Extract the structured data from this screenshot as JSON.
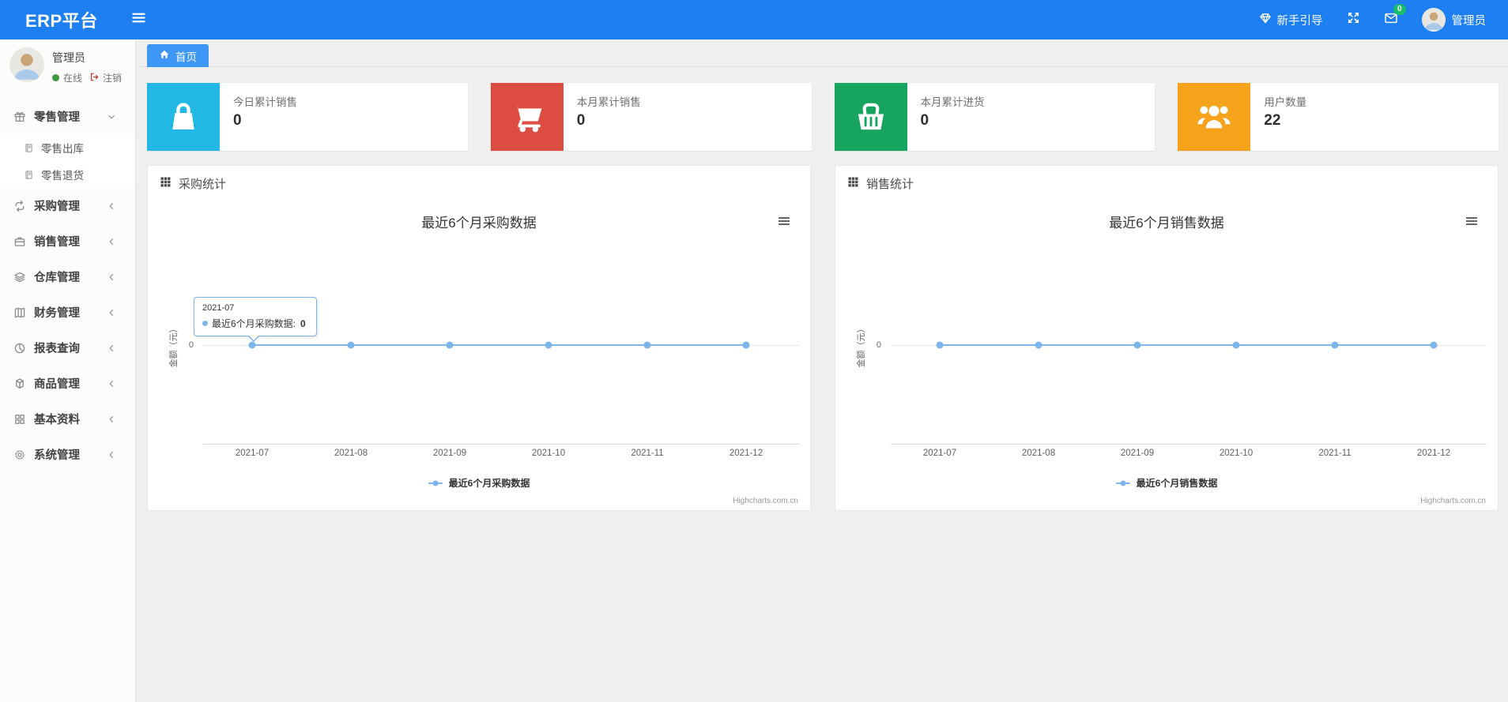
{
  "colors": {
    "navbar": "#1d7ff2",
    "active_tab": "#3f97f5",
    "badge_green": "#19be6b",
    "online_green": "#3c9a3c",
    "logout_red": "#c43a28",
    "chart_line": "#7cb5ec"
  },
  "navbar": {
    "brand": "ERP平台",
    "menu_icon": "hamburger-icon",
    "guide_icon": "gem-icon",
    "guide_label": "新手引导",
    "fullscreen_icon": "fullscreen-icon",
    "mail_icon": "mail-icon",
    "mail_badge": "0",
    "user_name": "管理员"
  },
  "sidebar": {
    "user": {
      "name": "管理员",
      "status": "在线",
      "logout": "注销"
    },
    "menu": [
      {
        "label": "零售管理",
        "icon": "gift-icon",
        "state": "expanded",
        "children": [
          {
            "label": "零售出库",
            "icon": "journal-icon"
          },
          {
            "label": "零售退货",
            "icon": "journal-icon"
          }
        ]
      },
      {
        "label": "采购管理",
        "icon": "repeat-icon"
      },
      {
        "label": "销售管理",
        "icon": "briefcase-icon"
      },
      {
        "label": "仓库管理",
        "icon": "layers-icon"
      },
      {
        "label": "财务管理",
        "icon": "ledger-icon"
      },
      {
        "label": "报表查询",
        "icon": "pie-icon"
      },
      {
        "label": "商品管理",
        "icon": "box-icon"
      },
      {
        "label": "基本资料",
        "icon": "grid-icon"
      },
      {
        "label": "系统管理",
        "icon": "gear-icon"
      }
    ]
  },
  "breadcrumb": {
    "home_icon": "home-icon",
    "home_label": "首页"
  },
  "stat_cards": [
    {
      "label": "今日累计销售",
      "value": "0",
      "color": "#23b7e5",
      "icon": "shopping-bag-icon"
    },
    {
      "label": "本月累计销售",
      "value": "0",
      "color": "#dc4c41",
      "icon": "shopping-cart-icon"
    },
    {
      "label": "本月累计进货",
      "value": "0",
      "color": "#17a45f",
      "icon": "shopping-basket-icon"
    },
    {
      "label": "用户数量",
      "value": "22",
      "color": "#f5a31b",
      "icon": "users-icon"
    }
  ],
  "chart_data": [
    {
      "type": "line",
      "panel_title": "采购统计",
      "panel_icon": "th-icon",
      "title": "最近6个月采购数据",
      "x": [
        "2021-07",
        "2021-08",
        "2021-09",
        "2021-10",
        "2021-11",
        "2021-12"
      ],
      "series": [
        {
          "name": "最近6个月采购数据",
          "values": [
            0,
            0,
            0,
            0,
            0,
            0
          ],
          "color": "#7cb5ec"
        }
      ],
      "ylabel": "金额（元）",
      "ytick": "0",
      "grid": true,
      "legend_position": "bottom",
      "credit": "Highcharts.com.cn",
      "tooltip": {
        "x": "2021-07",
        "series_label": "最近6个月采购数据: ",
        "value": "0"
      }
    },
    {
      "type": "line",
      "panel_title": "销售统计",
      "panel_icon": "th-icon",
      "title": "最近6个月销售数据",
      "x": [
        "2021-07",
        "2021-08",
        "2021-09",
        "2021-10",
        "2021-11",
        "2021-12"
      ],
      "series": [
        {
          "name": "最近6个月销售数据",
          "values": [
            0,
            0,
            0,
            0,
            0,
            0
          ],
          "color": "#7cb5ec"
        }
      ],
      "ylabel": "金额（元）",
      "ytick": "0",
      "grid": true,
      "legend_position": "bottom",
      "credit": "Highcharts.com.cn"
    }
  ]
}
